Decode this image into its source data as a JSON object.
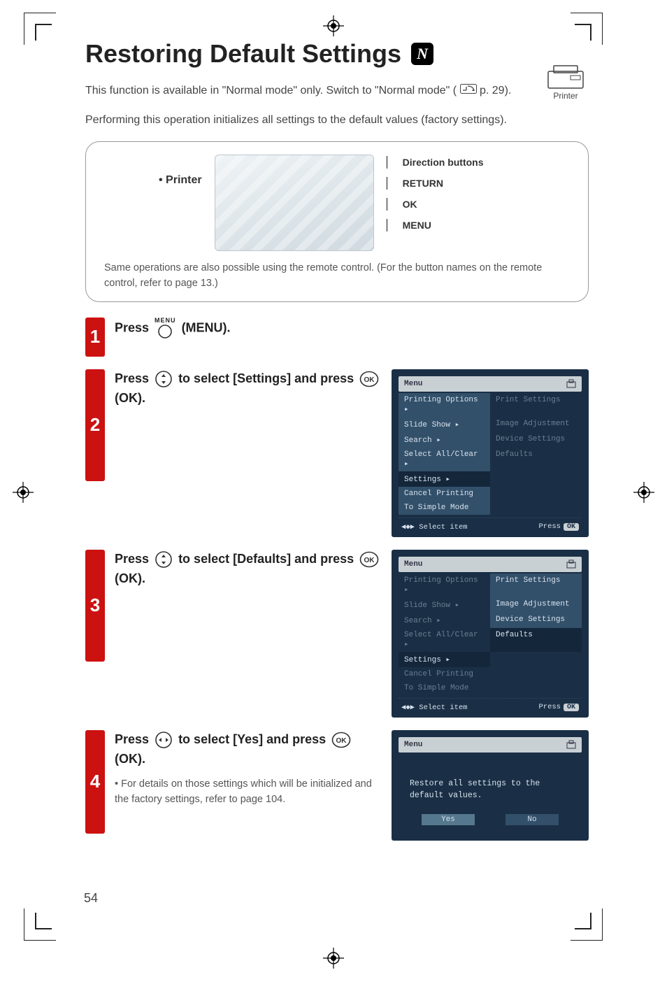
{
  "page_number": "54",
  "title": "Restoring Default Settings",
  "title_badge": "N",
  "printer_tag_label": "Printer",
  "intro_para_1_a": "This function is available in \"Normal mode\" only. Switch to \"Normal mode\" (",
  "intro_para_1_b": " p. 29).",
  "intro_para_2": "Performing this operation initializes all settings to the default values (factory settings).",
  "diagram": {
    "printer_label": "• Printer",
    "callouts": {
      "direction": "Direction buttons",
      "return": "RETURN",
      "ok": "OK",
      "menu": "MENU"
    },
    "note": "Same operations are also possible using the remote control. (For the button names on the remote control, refer to page 13.)"
  },
  "icons": {
    "menu_label": "MENU",
    "ok_label": "OK"
  },
  "steps": {
    "1": {
      "num": "1",
      "text_a": "Press ",
      "text_b": " (MENU)."
    },
    "2": {
      "num": "2",
      "text_a": "Press ",
      "text_b": " to select [Settings] and press ",
      "text_c": " (OK)."
    },
    "3": {
      "num": "3",
      "text_a": "Press ",
      "text_b": " to select [Defaults] and press ",
      "text_c": " (OK)."
    },
    "4": {
      "num": "4",
      "text_a": "Press ",
      "text_b": " to select [Yes] and press ",
      "text_c": " (OK).",
      "sub": "• For details on those settings which will be initialized and the factory settings, refer to page 104."
    }
  },
  "osd": {
    "header": "Menu",
    "left_items": [
      "Printing Options ▸",
      "Slide Show        ▸",
      "Search            ▸",
      "Select All/Clear ▸",
      "Settings         ▸",
      "Cancel Printing",
      "To Simple Mode"
    ],
    "right_items": [
      "Print Settings",
      "Image Adjustment",
      "Device Settings",
      "Defaults"
    ],
    "foot_left": "◀◆▶ Select item",
    "foot_right_a": "Press",
    "foot_right_b": "OK",
    "confirm_msg": "Restore all settings to the default values.",
    "yes": "Yes",
    "no": "No"
  }
}
